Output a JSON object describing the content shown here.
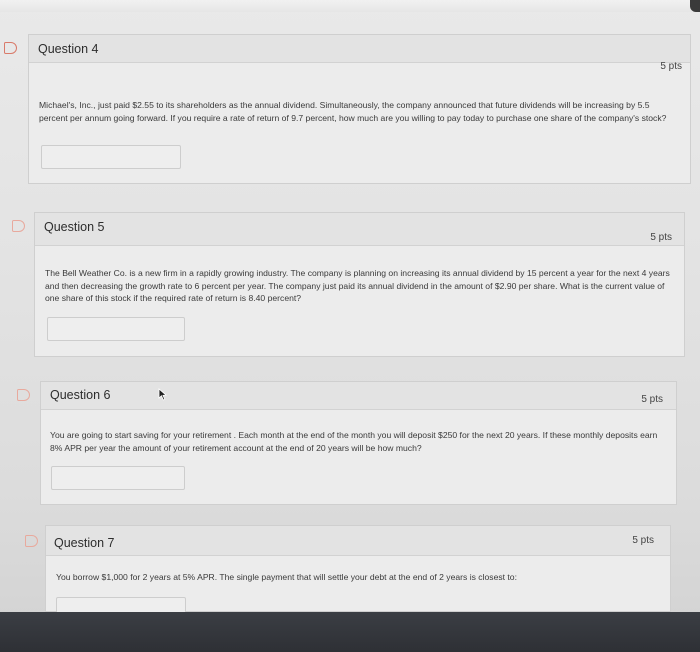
{
  "questions": [
    {
      "title": "Question 4",
      "points": "5 pts",
      "text": "Michael's, Inc., just paid $2.55 to its shareholders as the annual dividend. Simultaneously, the company announced that future dividends will be increasing by 5.5 percent per annum going forward. If you require a rate of return of 9.7 percent, how much are you willing to pay today to purchase one share of the company's stock?",
      "answer": ""
    },
    {
      "title": "Question 5",
      "points": "5 pts",
      "text": "The Bell Weather Co. is a new firm in a rapidly growing industry. The company is planning on increasing its annual dividend by 15 percent a year for the next 4 years and then decreasing the growth rate to 6 percent per year. The company just paid its annual dividend in the amount of $2.90 per share. What is the current value of one share of this stock if the required rate of return is 8.40 percent?",
      "answer": ""
    },
    {
      "title": "Question 6",
      "points": "5 pts",
      "text": "You are going to start saving for your retirement . Each month at the end of the month you will deposit $250 for the next 20 years. If these monthly deposits earn 8% APR per year the amount of your retirement account at the end of 20 years will be how much?",
      "answer": ""
    },
    {
      "title": "Question 7",
      "points": "5 pts",
      "text": "You borrow $1,000 for 2 years at 5% APR. The single payment that will settle your debt at the end of 2 years is closest to:",
      "answer": ""
    }
  ],
  "colors": {
    "flag": "#d97a6a",
    "bottom_bar": "#33363b"
  },
  "icons": {
    "flag": "flag-icon",
    "cursor": "mouse-cursor-icon",
    "corner": "browser-corner-icon"
  }
}
